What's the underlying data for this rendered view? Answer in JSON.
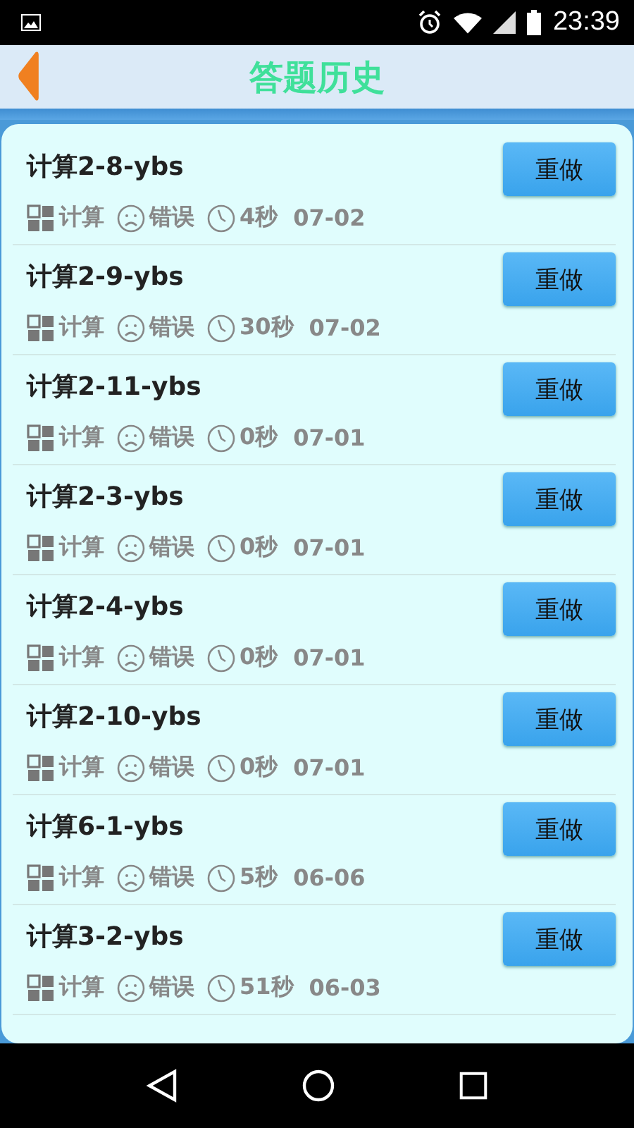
{
  "status_bar": {
    "time": "23:39"
  },
  "header": {
    "title": "答题历史"
  },
  "records": [
    {
      "title": "计算2-8-ybs",
      "category": "计算",
      "result": "错误",
      "duration": "4秒",
      "date": "07-02",
      "button": "重做"
    },
    {
      "title": "计算2-9-ybs",
      "category": "计算",
      "result": "错误",
      "duration": "30秒",
      "date": "07-02",
      "button": "重做"
    },
    {
      "title": "计算2-11-ybs",
      "category": "计算",
      "result": "错误",
      "duration": "0秒",
      "date": "07-01",
      "button": "重做"
    },
    {
      "title": "计算2-3-ybs",
      "category": "计算",
      "result": "错误",
      "duration": "0秒",
      "date": "07-01",
      "button": "重做"
    },
    {
      "title": "计算2-4-ybs",
      "category": "计算",
      "result": "错误",
      "duration": "0秒",
      "date": "07-01",
      "button": "重做"
    },
    {
      "title": "计算2-10-ybs",
      "category": "计算",
      "result": "错误",
      "duration": "0秒",
      "date": "07-01",
      "button": "重做"
    },
    {
      "title": "计算6-1-ybs",
      "category": "计算",
      "result": "错误",
      "duration": "5秒",
      "date": "06-06",
      "button": "重做"
    },
    {
      "title": "计算3-2-ybs",
      "category": "计算",
      "result": "错误",
      "duration": "51秒",
      "date": "06-03",
      "button": "重做"
    }
  ]
}
